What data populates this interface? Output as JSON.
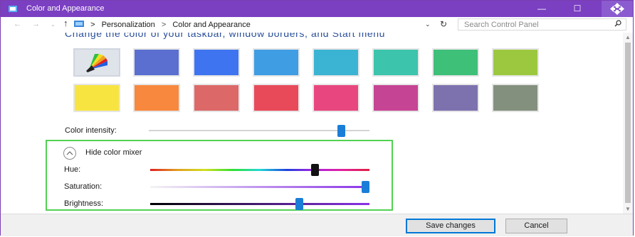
{
  "window": {
    "title": "Color and Appearance",
    "accent": "#7b3fc2"
  },
  "titlebar": {
    "minimize_glyph": "—",
    "maximize_glyph": "☐",
    "move_icon": "move-arrows-icon"
  },
  "address": {
    "back_glyph": "←",
    "forward_glyph": "→",
    "history_glyph": "⌄",
    "up_glyph": "↑",
    "separator": ">",
    "crumbs": [
      "Personalization",
      "Color and Appearance"
    ],
    "dropdown_glyph": "⌄",
    "refresh_glyph": "↻",
    "search_placeholder": "Search Control Panel"
  },
  "main": {
    "heading": "Change the color of your taskbar, window borders, and Start menu",
    "swatches": [
      {
        "name": "automatic",
        "color": "#dfe3ea"
      },
      {
        "name": "slate-blue",
        "color": "#5a6fd0"
      },
      {
        "name": "blue",
        "color": "#3f74f0"
      },
      {
        "name": "sky-blue",
        "color": "#3f9de4"
      },
      {
        "name": "teal-blue",
        "color": "#3bb3d2"
      },
      {
        "name": "teal",
        "color": "#3cc4ac"
      },
      {
        "name": "green",
        "color": "#3ec079"
      },
      {
        "name": "lime",
        "color": "#9cc840"
      },
      {
        "name": "yellow",
        "color": "#f8e440"
      },
      {
        "name": "orange",
        "color": "#f8883e"
      },
      {
        "name": "salmon",
        "color": "#dc6868"
      },
      {
        "name": "red",
        "color": "#e84a5a"
      },
      {
        "name": "pink",
        "color": "#e8467e"
      },
      {
        "name": "magenta",
        "color": "#c64494"
      },
      {
        "name": "purple-gray",
        "color": "#7e72ae"
      },
      {
        "name": "gray-green",
        "color": "#84907e"
      }
    ],
    "intensity_label": "Color intensity:",
    "intensity_value": 0.87,
    "mixer": {
      "toggle_label": "Hide color mixer",
      "hue_label": "Hue:",
      "hue_value": 0.75,
      "saturation_label": "Saturation:",
      "saturation_value": 1.0,
      "brightness_label": "Brightness:",
      "brightness_value": 0.68
    }
  },
  "footer": {
    "save_label": "Save changes",
    "cancel_label": "Cancel"
  }
}
